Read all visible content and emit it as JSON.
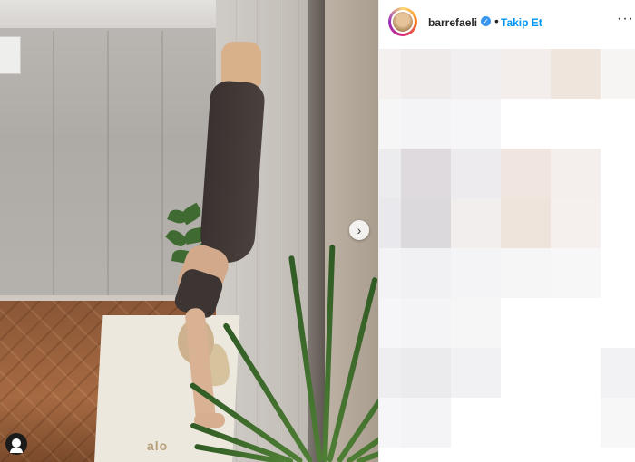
{
  "post": {
    "image": {
      "mat_logo": "alo"
    },
    "next_icon": "chevron-right-icon",
    "tag_icon": "user-tag-icon"
  },
  "header": {
    "username": "barrefaeli",
    "verified_icon": "verified-badge-icon",
    "separator": "•",
    "follow_label": "Takip Et",
    "more_icon": "more-options-icon",
    "more_glyph": "···"
  },
  "colors": {
    "follow_blue": "#0095f6",
    "verified_blue": "#3897f0"
  }
}
